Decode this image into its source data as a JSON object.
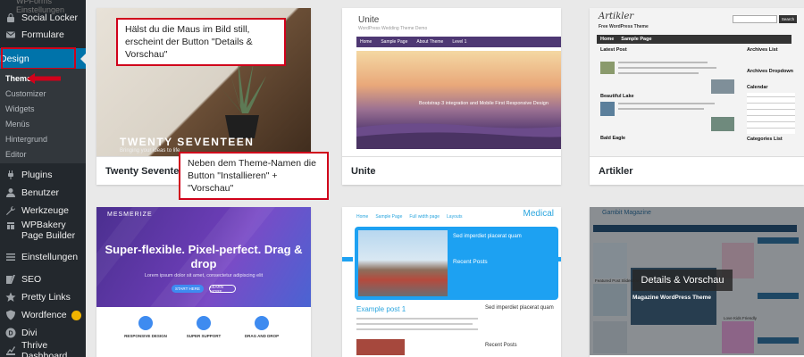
{
  "sidebar": {
    "top_faded_label": "WPForms Einstellungen",
    "items_top": [
      {
        "label": "Social Locker",
        "icon": "lock-icon"
      },
      {
        "label": "Formulare",
        "icon": "mail-icon"
      }
    ],
    "active": {
      "label": "Design",
      "icon": "paintbrush-icon"
    },
    "submenu": [
      "Themes",
      "Customizer",
      "Widgets",
      "Menüs",
      "Hintergrund",
      "Editor"
    ],
    "items_bottom": [
      {
        "label": "Plugins",
        "icon": "plug-icon"
      },
      {
        "label": "Benutzer",
        "icon": "user-icon"
      },
      {
        "label": "Werkzeuge",
        "icon": "wrench-icon"
      },
      {
        "label": "WPBakery Page Builder",
        "icon": "builder-icon"
      },
      {
        "label": "Einstellungen",
        "icon": "settings-icon"
      },
      {
        "label": "SEO",
        "icon": "seo-icon"
      },
      {
        "label": "Pretty Links",
        "icon": "star-icon"
      },
      {
        "label": "Wordfence",
        "icon": "shield-icon"
      },
      {
        "label": "Divi",
        "icon": "divi-icon"
      },
      {
        "label": "Thrive Dashboard",
        "icon": "dashboard-icon"
      }
    ],
    "highlight_color": "#d0021b",
    "active_color": "#0073aa"
  },
  "callouts": {
    "hover": "Hälst du die Maus im Bild still, erscheint der Button \"Details & Vorschau\"",
    "name": "Neben dem Theme-Namen die Button \"Installieren\" + \"Vorschau\""
  },
  "themes": [
    {
      "name": "Twenty Seventeen",
      "preview": {
        "title": "TWENTY SEVENTEEN",
        "subtitle": "Bringing your ideas to life"
      }
    },
    {
      "name": "Unite",
      "preview": {
        "logo": "Unite",
        "tagline": "WordPress Wedding Theme Demo",
        "nav": [
          "Home",
          "Sample Page",
          "About Theme",
          "Level 1"
        ],
        "hero_text": "Bootstrap 3 integration and Mobile First Responsive Design"
      }
    },
    {
      "name": "Artikler",
      "preview": {
        "logo": "Artikler",
        "tagline": "Free WordPress Theme",
        "search": "Search",
        "nav": [
          "Home",
          "Sample Page"
        ],
        "latest": "Latest Post",
        "side_titles": [
          "Archives List",
          "Archives Dropdown",
          "Calendar",
          "Categories List"
        ],
        "post_titles": [
          "Beautiful Lake",
          "Bald Eagle"
        ]
      }
    },
    {
      "name": "Mesmerize",
      "preview": {
        "logo": "MESMERIZE",
        "headline": "Super-flexible. Pixel-perfect. Drag & drop",
        "sub": "Lorem ipsum dolor sit amet, consectetur adipiscing elit",
        "btn1": "START HERE",
        "btn2": "LEARN MORE",
        "features": [
          "RESPONSIVE DESIGN",
          "SUPER SUPPORT",
          "DRAG AND DROP"
        ]
      }
    },
    {
      "name": "Medical",
      "preview": {
        "logo": "Medical",
        "nav": [
          "Home",
          "Sample Page",
          "Full width page",
          "Layouts"
        ],
        "slide_title": "Sed imperdiet placerat quam",
        "recent": "Recent Posts",
        "post_title": "Example post 1",
        "side_title": "Sed imperdiet placerat quam",
        "side_recent": "Recent Posts"
      }
    },
    {
      "name": "Gambit",
      "preview": {
        "logo": "Gambit Magazine",
        "hover_button": "Details & Vorschau",
        "mag_title": "Magazine WordPress Theme",
        "featured_label": "Featured Post Slideshow",
        "tile_label": "Love Kids Friendly"
      }
    }
  ]
}
